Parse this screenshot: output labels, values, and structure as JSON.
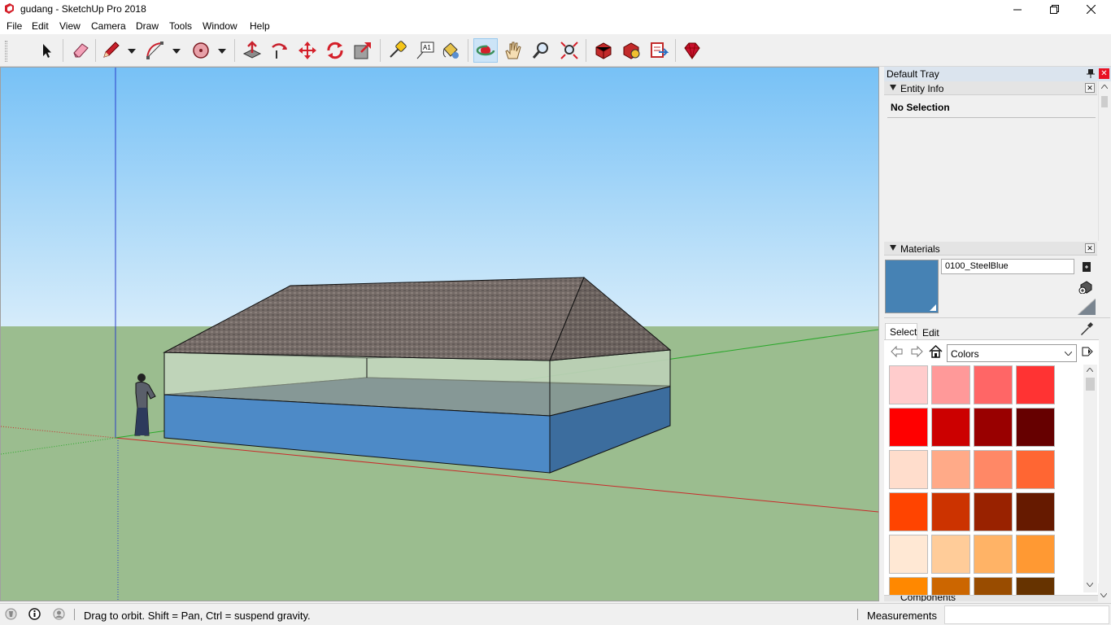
{
  "window": {
    "title": "gudang - SketchUp Pro 2018"
  },
  "menu": [
    "File",
    "Edit",
    "View",
    "Camera",
    "Draw",
    "Tools",
    "Window",
    "Help"
  ],
  "tray": {
    "title": "Default Tray",
    "entity_info": {
      "label": "Entity Info",
      "selection": "No Selection"
    },
    "materials": {
      "label": "Materials",
      "current_name": "0100_SteelBlue",
      "current_color": "#4682b4",
      "tabs": [
        "Select",
        "Edit"
      ],
      "library": "Colors",
      "swatches": [
        [
          "#ffcccc",
          "#ff9999",
          "#ff6666",
          "#ff3333"
        ],
        [
          "#ff0000",
          "#cc0000",
          "#990000",
          "#660000"
        ],
        [
          "#ffddcc",
          "#ffaa88",
          "#ff8866",
          "#ff6633"
        ],
        [
          "#ff4400",
          "#cc3300",
          "#992200",
          "#661a00"
        ],
        [
          "#ffe8d4",
          "#ffcc99",
          "#ffb366",
          "#ff9933"
        ],
        [
          "#ff8800",
          "#cc6600",
          "#994c00",
          "#663300"
        ]
      ],
      "next_section": "Components"
    }
  },
  "status": {
    "message": "Drag to orbit. Shift = Pan, Ctrl = suspend gravity.",
    "measurements_label": "Measurements",
    "measurements_value": ""
  },
  "colors": {
    "sky_top": "#77c1f6",
    "sky_bottom": "#d6ecfa",
    "ground": "#9bbd8f",
    "wall_blue": "#4d8ac7",
    "selection_accent": "#cce4f7"
  }
}
